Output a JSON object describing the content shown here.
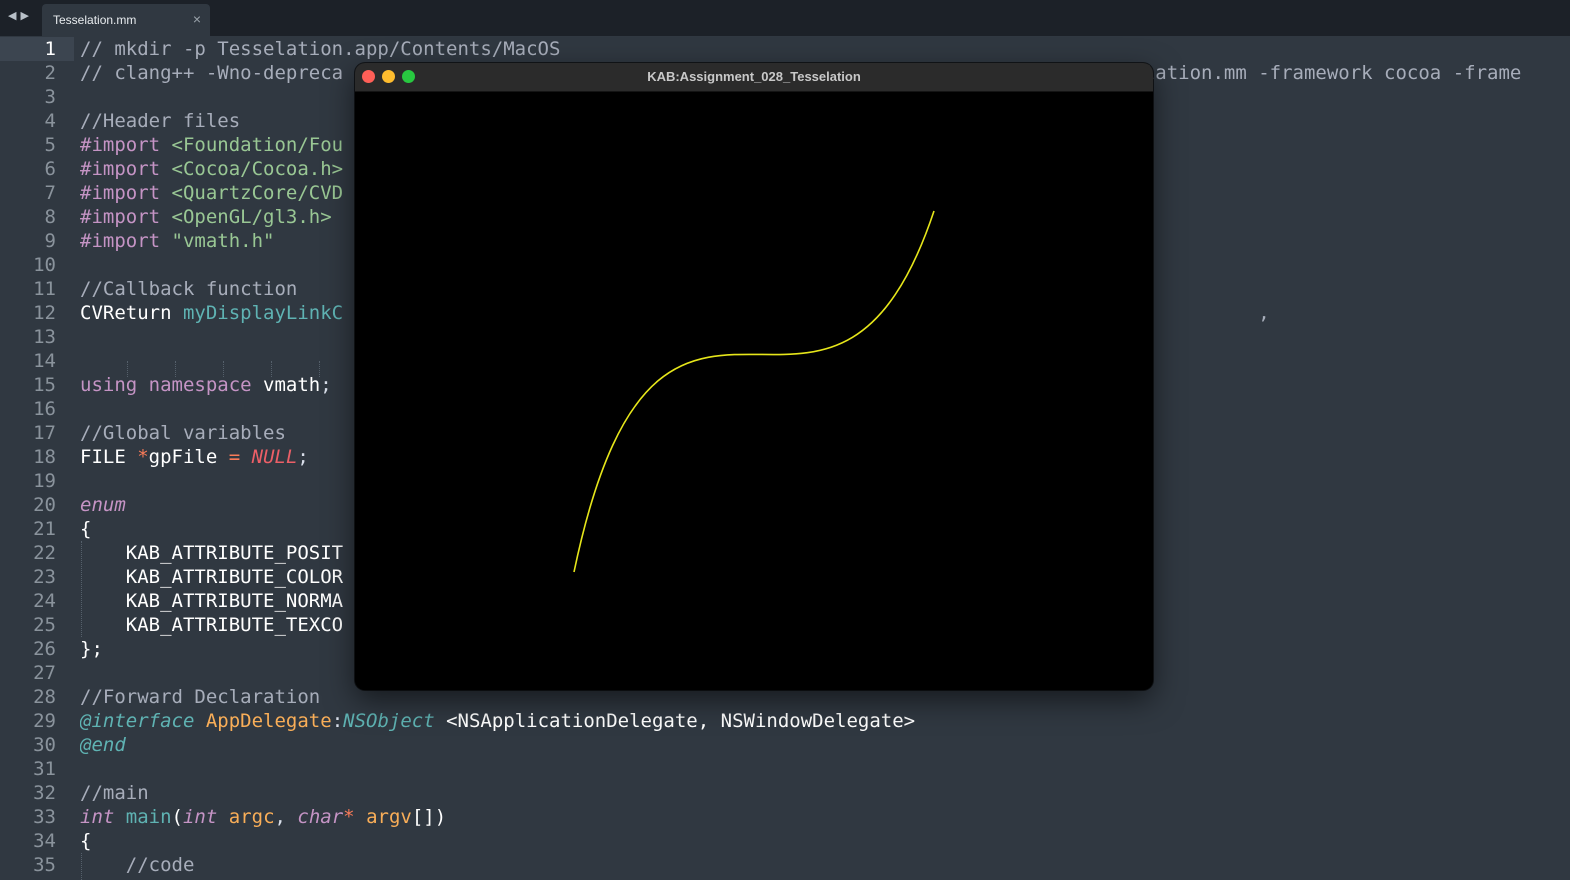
{
  "tabbar": {
    "back_icon": "◀",
    "forward_icon": "▶",
    "tab": {
      "label": "Tesselation.mm",
      "close": "×"
    }
  },
  "editor": {
    "current_line": 1,
    "line_numbers": [
      "1",
      "2",
      "3",
      "4",
      "5",
      "6",
      "7",
      "8",
      "9",
      "10",
      "11",
      "12",
      "13",
      "14",
      "15",
      "16",
      "17",
      "18",
      "19",
      "20",
      "21",
      "22",
      "23",
      "24",
      "25",
      "26",
      "27",
      "28",
      "29",
      "30",
      "31",
      "32",
      "33",
      "34",
      "35"
    ],
    "lines": [
      [
        {
          "t": "// mkdir -p Tesselation.app/Contents/MacOS",
          "c": "c-com"
        }
      ],
      [
        {
          "t": "// clang++ -Wno-depreca",
          "c": "c-com"
        },
        {
          "t": "                                                                    selation.mm -framework cocoa -frame",
          "c": "c-com"
        }
      ],
      [],
      [
        {
          "t": "//Header files",
          "c": "c-com"
        }
      ],
      [
        {
          "t": "#import ",
          "c": "c-kw"
        },
        {
          "t": "<Foundation/Fou",
          "c": "c-str"
        }
      ],
      [
        {
          "t": "#import ",
          "c": "c-kw"
        },
        {
          "t": "<Cocoa/Cocoa.h>",
          "c": "c-str"
        }
      ],
      [
        {
          "t": "#import ",
          "c": "c-kw"
        },
        {
          "t": "<QuartzCore/CVD",
          "c": "c-str"
        }
      ],
      [
        {
          "t": "#import ",
          "c": "c-kw"
        },
        {
          "t": "<OpenGL/gl3.h>",
          "c": "c-str"
        }
      ],
      [
        {
          "t": "#import ",
          "c": "c-kw"
        },
        {
          "t": "\"vmath.h\"",
          "c": "c-str"
        }
      ],
      [],
      [
        {
          "t": "//Callback function",
          "c": "c-com"
        }
      ],
      [
        {
          "t": "CVReturn ",
          "c": "c-white"
        },
        {
          "t": "myDisplayLinkC",
          "c": "c-fn"
        },
        {
          "t": "                                                                                ,",
          "c": "c-com"
        }
      ],
      [],
      [],
      [
        {
          "t": "using ",
          "c": "c-kw"
        },
        {
          "t": "namespace ",
          "c": "c-kw"
        },
        {
          "t": "vmath",
          "c": "c-white"
        },
        {
          "t": ";",
          "c": ""
        }
      ],
      [],
      [
        {
          "t": "//Global variables",
          "c": "c-com"
        }
      ],
      [
        {
          "t": "FILE ",
          "c": "c-white"
        },
        {
          "t": "*",
          "c": "c-op"
        },
        {
          "t": "gpFile ",
          "c": "c-white"
        },
        {
          "t": "= ",
          "c": "c-op"
        },
        {
          "t": "NULL",
          "c": "c-red"
        },
        {
          "t": ";",
          "c": ""
        }
      ],
      [],
      [
        {
          "t": "enum",
          "c": "c-ital-kw"
        }
      ],
      [
        {
          "t": "{",
          "c": "c-white"
        }
      ],
      [
        {
          "t": "    KAB_ATTRIBUTE_POSIT",
          "c": "c-white"
        }
      ],
      [
        {
          "t": "    KAB_ATTRIBUTE_COLOR",
          "c": "c-white"
        }
      ],
      [
        {
          "t": "    KAB_ATTRIBUTE_NORMA",
          "c": "c-white"
        }
      ],
      [
        {
          "t": "    KAB_ATTRIBUTE_TEXCO",
          "c": "c-white"
        }
      ],
      [
        {
          "t": "};",
          "c": "c-white"
        }
      ],
      [],
      [
        {
          "t": "//Forward Declaration",
          "c": "c-com"
        }
      ],
      [
        {
          "t": "@interface ",
          "c": "c-ital-teal"
        },
        {
          "t": "AppDelegate",
          "c": "c-orange"
        },
        {
          "t": ":",
          "c": ""
        },
        {
          "t": "NSObject ",
          "c": "c-ital-teal"
        },
        {
          "t": "<NSApplicationDelegate, NSWindowDelegate>",
          "c": "c-white"
        }
      ],
      [
        {
          "t": "@end",
          "c": "c-ital-teal"
        }
      ],
      [],
      [
        {
          "t": "//main",
          "c": "c-com"
        }
      ],
      [
        {
          "t": "int ",
          "c": "c-ital-kw"
        },
        {
          "t": "main",
          "c": "c-fn"
        },
        {
          "t": "(",
          "c": "c-white"
        },
        {
          "t": "int ",
          "c": "c-ital-kw"
        },
        {
          "t": "argc",
          "c": "c-orange"
        },
        {
          "t": ", ",
          "c": ""
        },
        {
          "t": "char",
          "c": "c-ital-kw"
        },
        {
          "t": "* ",
          "c": "c-op"
        },
        {
          "t": "argv",
          "c": "c-orange"
        },
        {
          "t": "[])",
          "c": "c-white"
        }
      ],
      [
        {
          "t": "{",
          "c": "c-white"
        }
      ],
      [
        {
          "t": "    //code",
          "c": "c-com"
        }
      ]
    ]
  },
  "app_window": {
    "title": "KAB:Assignment_028_Tesselation",
    "canvas_background": "#000000",
    "curve_color": "#e6e61a"
  },
  "colors": {
    "editor_bg": "#303841",
    "tabbar_bg": "#1c2128",
    "close_button": "#ff5f57",
    "minimize_button": "#febc2e",
    "maximize_button": "#28c840"
  }
}
